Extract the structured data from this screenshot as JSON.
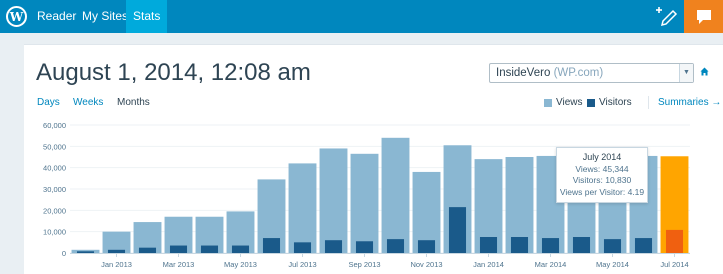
{
  "topbar": {
    "nav": [
      {
        "label": "Reader",
        "active": false
      },
      {
        "label": "My Sites",
        "active": false
      },
      {
        "label": "Stats",
        "active": true
      }
    ]
  },
  "header": {
    "title": "August 1, 2014, 12:08 am",
    "site_select": {
      "name": "InsideVero",
      "suffix": "(WP.com)"
    }
  },
  "period_tabs": [
    {
      "label": "Days",
      "active": false
    },
    {
      "label": "Weeks",
      "active": false
    },
    {
      "label": "Months",
      "active": true
    }
  ],
  "legend": {
    "views_label": "Views",
    "visitors_label": "Visitors",
    "summaries_label": "Summaries"
  },
  "colors": {
    "views": "#8ab7d2",
    "visitors": "#1a5a8a",
    "highlight_views": "#ffa500",
    "highlight_visitors": "#f06010",
    "topbar": "#0087be"
  },
  "chart_data": {
    "type": "bar",
    "y_ticks": [
      "0",
      "10,000",
      "20,000",
      "30,000",
      "40,000",
      "50,000",
      "60,000"
    ],
    "ylim": [
      0,
      60000
    ],
    "x_ticks": [
      {
        "index": 1,
        "label": "Jan 2013"
      },
      {
        "index": 3,
        "label": "Mar 2013"
      },
      {
        "index": 5,
        "label": "May 2013"
      },
      {
        "index": 7,
        "label": "Jul 2013"
      },
      {
        "index": 9,
        "label": "Sep 2013"
      },
      {
        "index": 11,
        "label": "Nov 2013"
      },
      {
        "index": 13,
        "label": "Jan 2014"
      },
      {
        "index": 15,
        "label": "Mar 2014"
      },
      {
        "index": 17,
        "label": "May 2014"
      },
      {
        "index": 19,
        "label": "Jul 2014"
      }
    ],
    "series": [
      {
        "name": "Views",
        "values": [
          1500,
          10000,
          14500,
          17000,
          17000,
          19500,
          34500,
          42000,
          49000,
          46500,
          54000,
          38000,
          50500,
          44000,
          45000,
          45500,
          46000,
          45000,
          45500,
          45344
        ]
      },
      {
        "name": "Visitors",
        "values": [
          800,
          1500,
          2500,
          3500,
          3500,
          3500,
          7000,
          5000,
          6000,
          5500,
          6500,
          6000,
          21500,
          7500,
          7500,
          7000,
          7500,
          6500,
          7000,
          10830
        ]
      }
    ],
    "highlight_index": 19,
    "grid": true
  },
  "tooltip": {
    "title": "July 2014",
    "views": "Views: 45,344",
    "visitors": "Visitors: 10,830",
    "views_per_visitor": "Views per Visitor: 4.19"
  }
}
